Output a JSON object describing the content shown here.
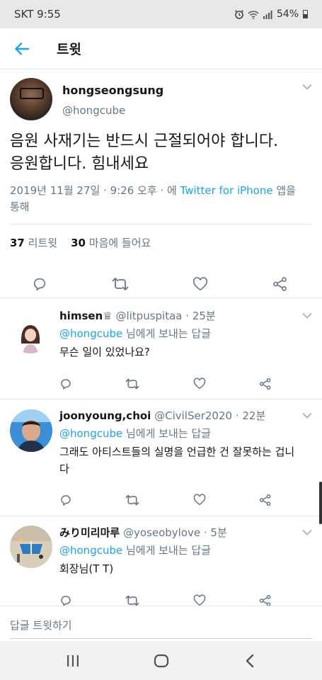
{
  "status": {
    "carrier_time": "SKT 9:55",
    "battery": "54%"
  },
  "header": {
    "title": "트윗"
  },
  "main_tweet": {
    "name": "hongseongsung",
    "handle": "@hongcube",
    "text_line1": "음원 사재기는 반드시 근절되어야 합니다.",
    "text_line2": "응원합니다. 힘내세요",
    "meta_prefix": "2019년 11월 27일 · 9:26 오후 · 에 ",
    "meta_link": "Twitter for iPhone",
    "meta_suffix": " 앱을",
    "meta_line2": "통해",
    "retweet_count": "37",
    "retweet_label": " 리트윗",
    "like_count": "30",
    "like_label": " 마음에 들어요"
  },
  "replies": [
    {
      "name": "himsen♕",
      "handle": "@litpuspitaa · 25분",
      "mention": "@hongcube",
      "replying_suffix": " 님에게 보내는 답글",
      "text": "무슨 일이 있었나요?"
    },
    {
      "name": "joonyoung,choi",
      "handle": "@CivilSer2020 · 22분",
      "mention": "@hongcube",
      "replying_suffix": " 님에게 보내는 답글",
      "text": "그래도 아티스트들의 실명을 언급한 건 잘못하는 겁니다"
    },
    {
      "name": "みり미리마루",
      "handle": "@yoseobylove · 5분",
      "mention": "@hongcube",
      "replying_suffix": " 님에게 보내는 답글",
      "text": "회장님(T T)"
    }
  ],
  "compose": {
    "placeholder": "답글 트윗하기"
  },
  "colors": {
    "accent": "#1da1f2",
    "secondary_text": "#657786",
    "divider": "#e1e8ed"
  },
  "icons": [
    "back-arrow-icon",
    "chevron-down-icon",
    "reply-icon",
    "retweet-icon",
    "like-icon",
    "share-icon",
    "recent-apps-icon",
    "home-icon",
    "back-nav-icon",
    "alarm-icon",
    "wifi-icon",
    "signal-icon",
    "battery-icon"
  ]
}
